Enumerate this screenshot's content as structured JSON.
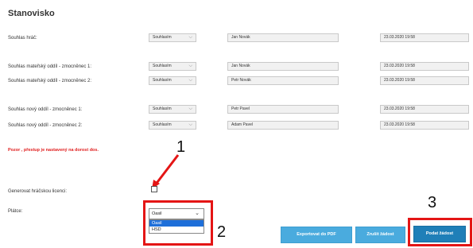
{
  "heading": "Stanovisko",
  "rows": [
    {
      "label": "Souhlas hráč:",
      "status": "Souhlasím",
      "name": "Jan Novák",
      "datetime": "23.03.2020 19:58"
    },
    {
      "label": "Souhlas mateřský oddíl - zmocněnec 1:",
      "status": "Souhlasím",
      "name": "Jan Novák",
      "datetime": "23.03.2020 19:58"
    },
    {
      "label": "Souhlas mateřský oddíl - zmocněnec 2:",
      "status": "Souhlasím",
      "name": "Petr Novák",
      "datetime": "23.03.2020 19:58"
    },
    {
      "label": "Souhlas nový oddíl - zmocněnec 1:",
      "status": "Souhlasím",
      "name": "Petr Pavel",
      "datetime": "23.03.2020 19:58"
    },
    {
      "label": "Souhlas nový oddíl - zmocněnec 2:",
      "status": "Souhlasím",
      "name": "Adam Pavel",
      "datetime": "23.03.2020 19:58"
    }
  ],
  "warning": "Pozor , přestup je nastavený na dorost dos.",
  "license_label": "Generovat hráčskou licenci:",
  "license_checked": false,
  "payer_label": "Plátce:",
  "payer_select": {
    "value": "Oasil",
    "options": [
      "Oasil",
      "HSD"
    ],
    "highlighted": "Oasil"
  },
  "callouts": [
    "1",
    "2",
    "3"
  ],
  "buttons": {
    "export": "Exportovat do PDF",
    "cancel": "Zrušit žádost",
    "submit": "Podat žádost"
  },
  "colors": {
    "warning": "#e02020",
    "callout_box": "#e41515",
    "button_light": "#4aabde",
    "button_dark": "#1f7fb8"
  }
}
